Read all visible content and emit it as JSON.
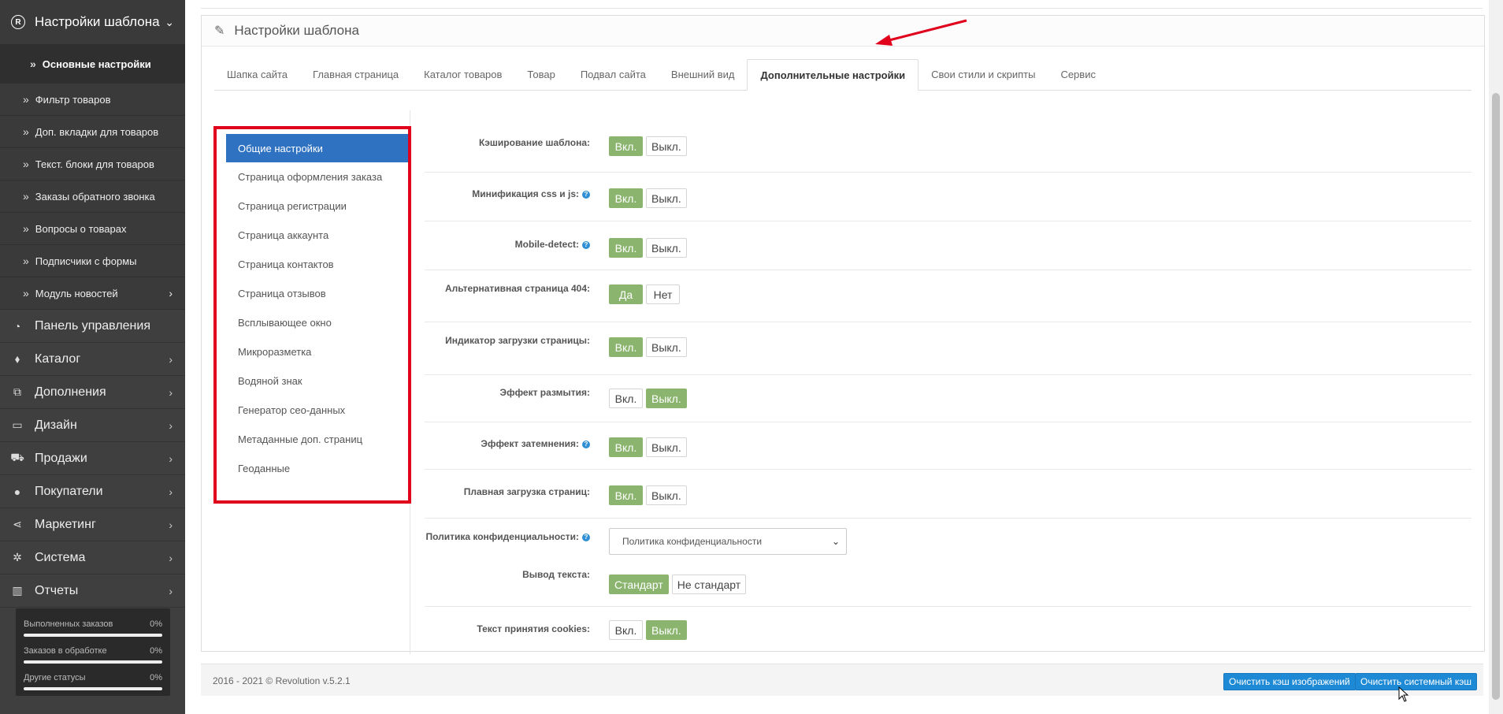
{
  "sidebar": {
    "header": {
      "title": "Настройки шаблона",
      "icon": "registered-icon"
    },
    "sub_items": [
      {
        "label": "Основные настройки",
        "active": true
      },
      {
        "label": "Фильтр товаров"
      },
      {
        "label": "Доп. вкладки для товаров"
      },
      {
        "label": "Текст. блоки для товаров"
      },
      {
        "label": "Заказы обратного звонка"
      },
      {
        "label": "Вопросы о товарах"
      },
      {
        "label": "Подписчики с формы"
      },
      {
        "label": "Модуль новостей",
        "has_children": true
      }
    ],
    "main_items": [
      {
        "label": "Панель управления",
        "icon": "dashboard-icon"
      },
      {
        "label": "Каталог",
        "icon": "tags-icon"
      },
      {
        "label": "Дополнения",
        "icon": "puzzle-icon"
      },
      {
        "label": "Дизайн",
        "icon": "monitor-icon"
      },
      {
        "label": "Продажи",
        "icon": "cart-icon"
      },
      {
        "label": "Покупатели",
        "icon": "user-icon"
      },
      {
        "label": "Маркетинг",
        "icon": "share-icon"
      },
      {
        "label": "Система",
        "icon": "cog-icon"
      },
      {
        "label": "Отчеты",
        "icon": "bar-chart-icon"
      }
    ],
    "stats": [
      {
        "label": "Выполненных заказов",
        "value": "0%",
        "progress": 0
      },
      {
        "label": "Заказов в обработке",
        "value": "0%",
        "progress": 0
      },
      {
        "label": "Другие статусы",
        "value": "0%",
        "progress": 0
      }
    ]
  },
  "panel": {
    "title": "Настройки шаблона",
    "tabs": [
      {
        "label": "Шапка сайта"
      },
      {
        "label": "Главная страница"
      },
      {
        "label": "Каталог товаров"
      },
      {
        "label": "Товар"
      },
      {
        "label": "Подвал сайта"
      },
      {
        "label": "Внешний вид"
      },
      {
        "label": "Дополнительные настройки",
        "active": true
      },
      {
        "label": "Свои стили и скрипты"
      },
      {
        "label": "Сервис"
      }
    ],
    "subnav": [
      {
        "label": "Общие настройки",
        "active": true
      },
      {
        "label": "Страница оформления заказа"
      },
      {
        "label": "Страница регистрации"
      },
      {
        "label": "Страница аккаунта"
      },
      {
        "label": "Страница контактов"
      },
      {
        "label": "Страница отзывов"
      },
      {
        "label": "Всплывающее окно"
      },
      {
        "label": "Микроразметка"
      },
      {
        "label": "Водяной знак"
      },
      {
        "label": "Генератор сео-данных"
      },
      {
        "label": "Метаданные доп. страниц"
      },
      {
        "label": "Геоданные"
      }
    ],
    "settings": [
      {
        "label": "Кэширование шаблона:",
        "options": [
          "Вкл.",
          "Выкл."
        ],
        "selected": 0
      },
      {
        "label": "Минификация css и js:",
        "help": true,
        "options": [
          "Вкл.",
          "Выкл."
        ],
        "selected": 0
      },
      {
        "label": "Mobile-detect:",
        "help": true,
        "options": [
          "Вкл.",
          "Выкл."
        ],
        "selected": 0
      },
      {
        "label": "Альтернативная страница 404:",
        "options": [
          "Да",
          "Нет"
        ],
        "selected": 0
      },
      {
        "label": "Индикатор загрузки страницы:",
        "options": [
          "Вкл.",
          "Выкл."
        ],
        "selected": 0
      },
      {
        "label": "Эффект размытия:",
        "options": [
          "Вкл.",
          "Выкл."
        ],
        "selected": 1
      },
      {
        "label": "Эффект затемнения:",
        "help": true,
        "options": [
          "Вкл.",
          "Выкл."
        ],
        "selected": 0
      },
      {
        "label": "Плавная загрузка страниц:",
        "options": [
          "Вкл.",
          "Выкл."
        ],
        "selected": 0
      },
      {
        "label": "Политика конфиденциальности:",
        "help": true,
        "select_value": "Политика конфиденциальности"
      },
      {
        "label": "Вывод текста:",
        "options": [
          "Стандарт",
          "Не стандарт"
        ],
        "selected": 0
      },
      {
        "label": "Текст принятия cookies:",
        "options": [
          "Вкл.",
          "Выкл."
        ],
        "selected": 1
      }
    ]
  },
  "footer": {
    "copyright": "2016 - 2021 © Revolution v.5.2.1",
    "clear_images_label": "Очистить кэш изображений",
    "clear_system_label": "Очистить системный кэш"
  },
  "colors": {
    "sidebar_bg": "#3f3f3f",
    "active_nav": "#2f72c1",
    "toggle_on": "#8bb56f",
    "highlight_red": "#e0001b",
    "primary_button": "#1e8ad6"
  }
}
